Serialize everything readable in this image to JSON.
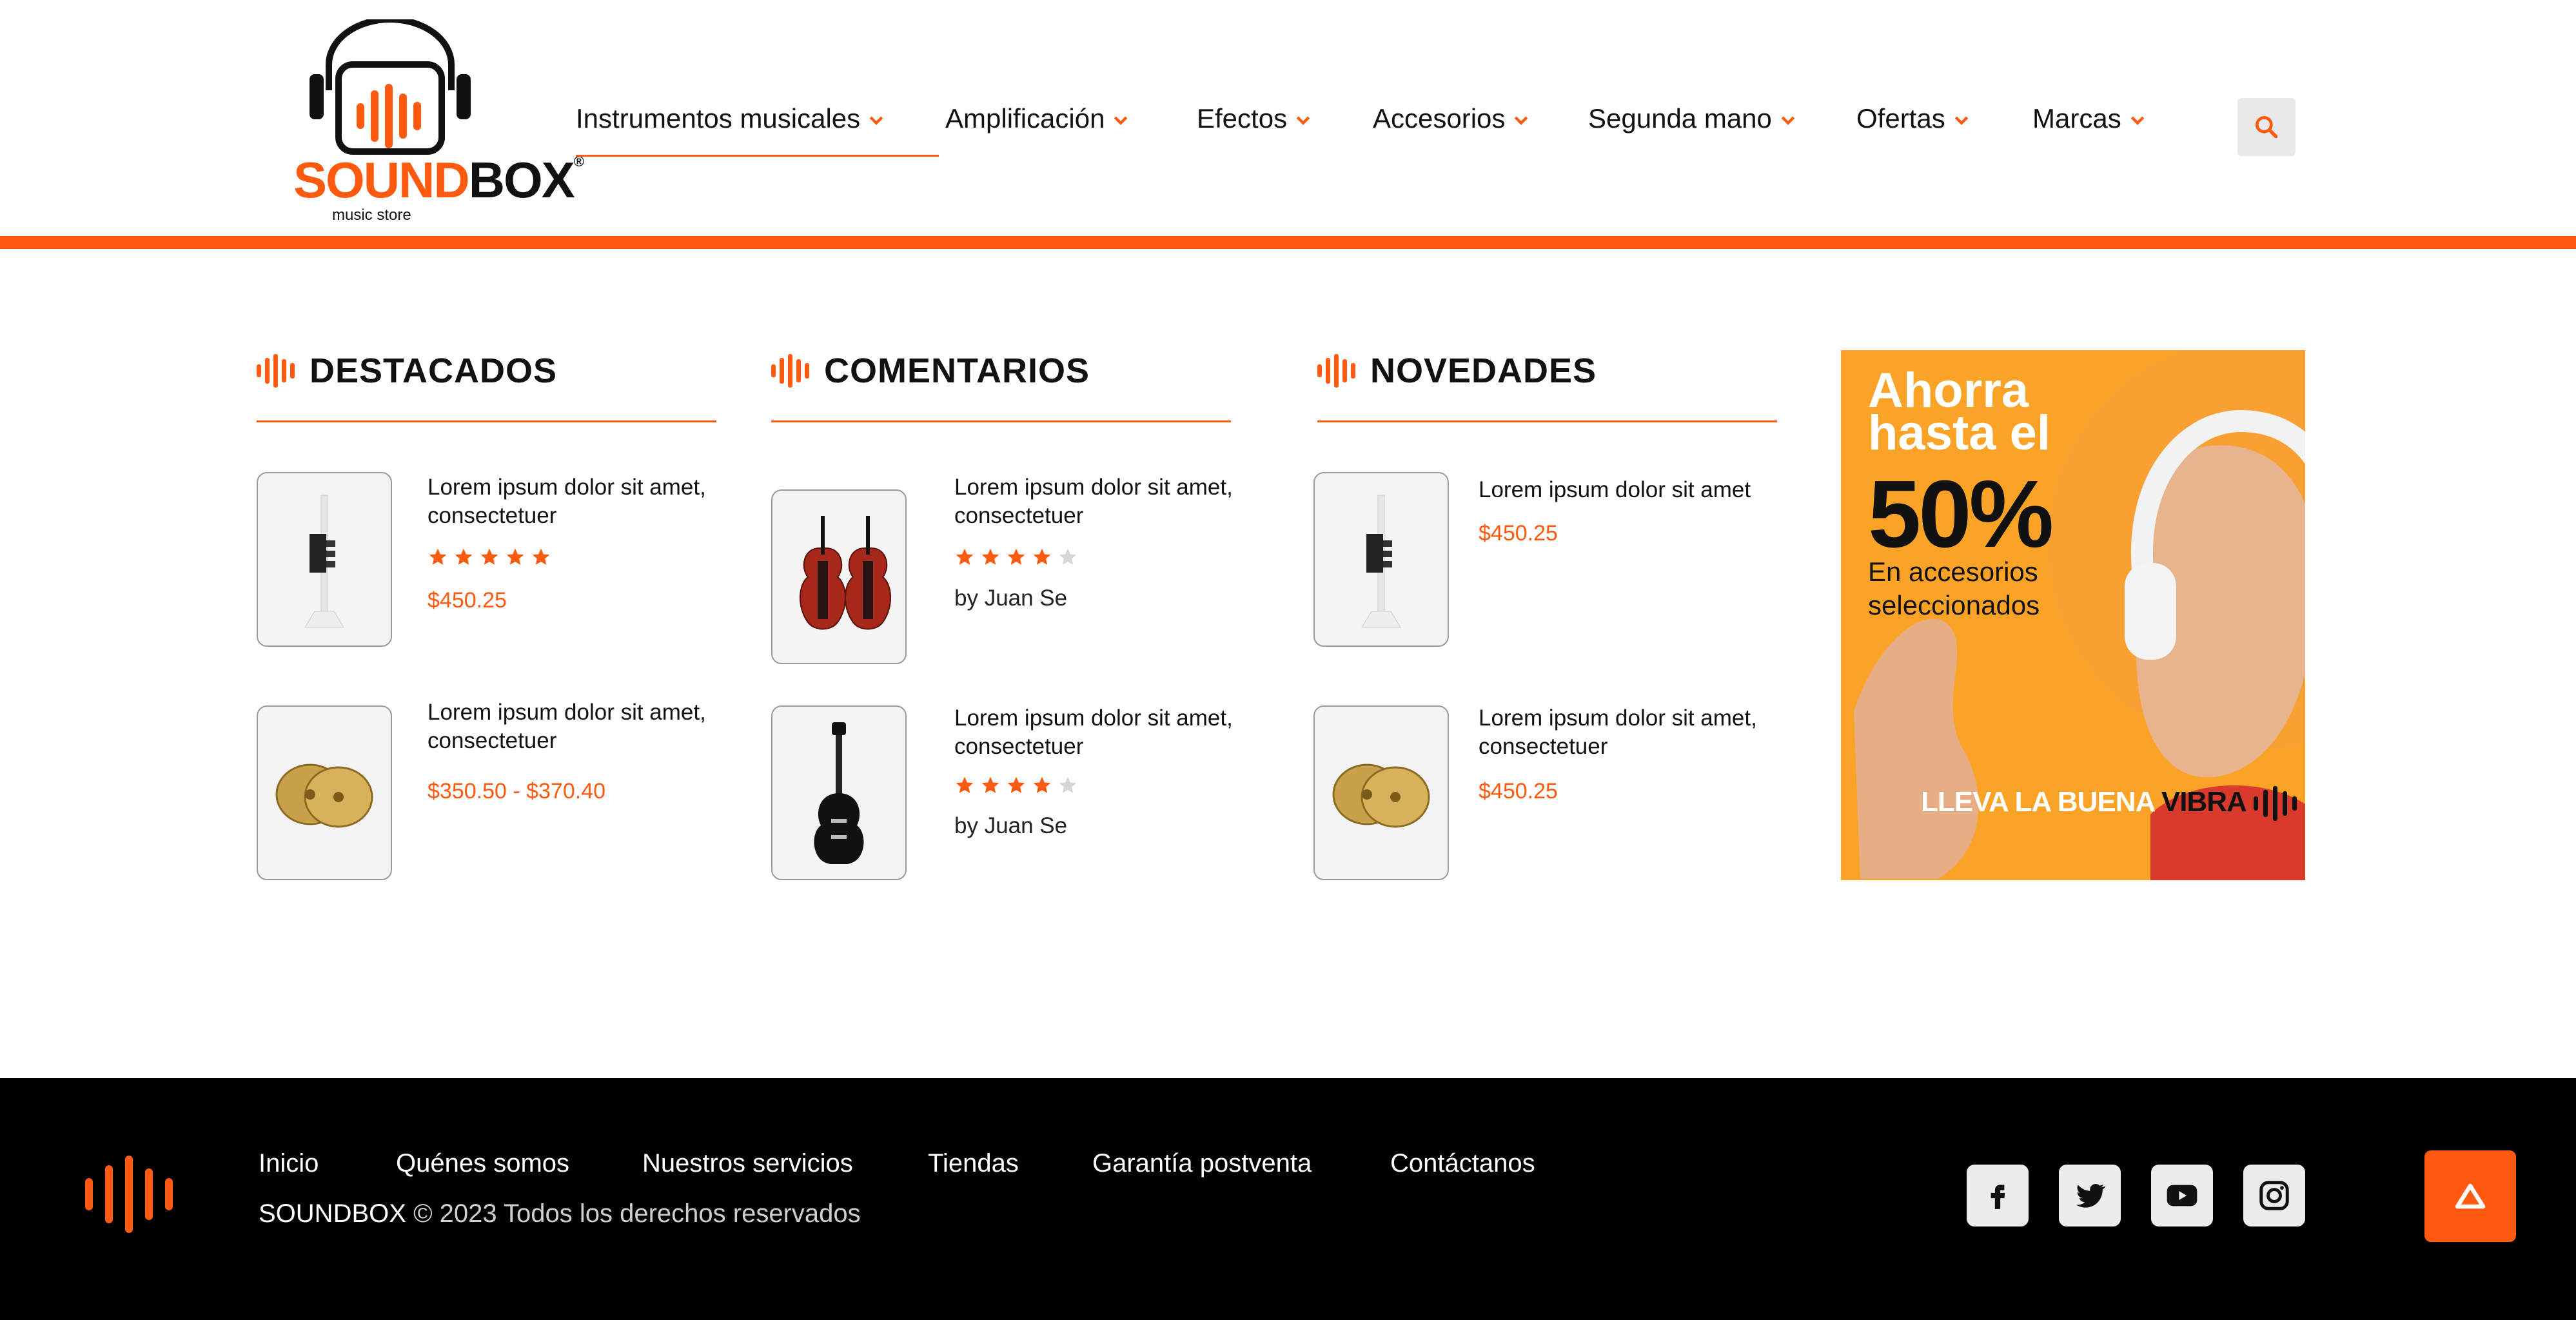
{
  "brand": {
    "name_part1": "SOUND",
    "name_part2": "BOX",
    "tagline": "music store",
    "registered": "®"
  },
  "nav": {
    "items": [
      {
        "label": "Instrumentos musicales"
      },
      {
        "label": "Amplificación"
      },
      {
        "label": "Efectos"
      },
      {
        "label": "Accesorios"
      },
      {
        "label": "Segunda mano"
      },
      {
        "label": "Ofertas"
      },
      {
        "label": "Marcas"
      }
    ]
  },
  "sections": {
    "destacados": {
      "title": "DESTACADOS",
      "items": [
        {
          "title": "Lorem ipsum dolor sit amet, consectetuer",
          "rating": 5,
          "price": "$450.25",
          "image": "trumpet"
        },
        {
          "title": "Lorem ipsum dolor sit amet, consectetuer",
          "price": "$350.50 - $370.40",
          "image": "cymbals"
        }
      ]
    },
    "comentarios": {
      "title": "COMENTARIOS",
      "items": [
        {
          "title": "Lorem ipsum dolor sit amet, consectetuer",
          "rating": 4,
          "byline": "by Juan Se",
          "image": "violins"
        },
        {
          "title": "Lorem ipsum dolor sit amet, consectetuer",
          "rating": 4,
          "byline": "by Juan Se",
          "image": "guitar"
        }
      ]
    },
    "novedades": {
      "title": "NOVEDADES",
      "items": [
        {
          "title": "Lorem ipsum dolor sit amet",
          "price": "$450.25",
          "image": "trumpet"
        },
        {
          "title": "Lorem ipsum dolor sit amet, consectetuer",
          "price": "$450.25",
          "image": "cymbals"
        }
      ]
    }
  },
  "promo": {
    "headline_line1": "Ahorra",
    "headline_line2": "hasta el",
    "percent": "50%",
    "sub_line1": "En accesorios",
    "sub_line2": "seleccionados",
    "slogan": "LLEVA LA BUENA",
    "slogan_accent": "VIBRA"
  },
  "footer": {
    "links": [
      {
        "label": "Inicio"
      },
      {
        "label": "Quénes somos"
      },
      {
        "label": "Nuestros servicios"
      },
      {
        "label": "Tiendas"
      },
      {
        "label": "Garantía postventa"
      },
      {
        "label": "Contáctanos"
      }
    ],
    "copyright_brand": "SOUNDBOX",
    "copyright_text": "© 2023 Todos los derechos reservados",
    "social": [
      "facebook-icon",
      "twitter-icon",
      "youtube-icon",
      "instagram-icon"
    ]
  },
  "colors": {
    "accent": "#FF5A0F",
    "footer_bg": "#000000",
    "promo_bg": "#FBA326"
  }
}
